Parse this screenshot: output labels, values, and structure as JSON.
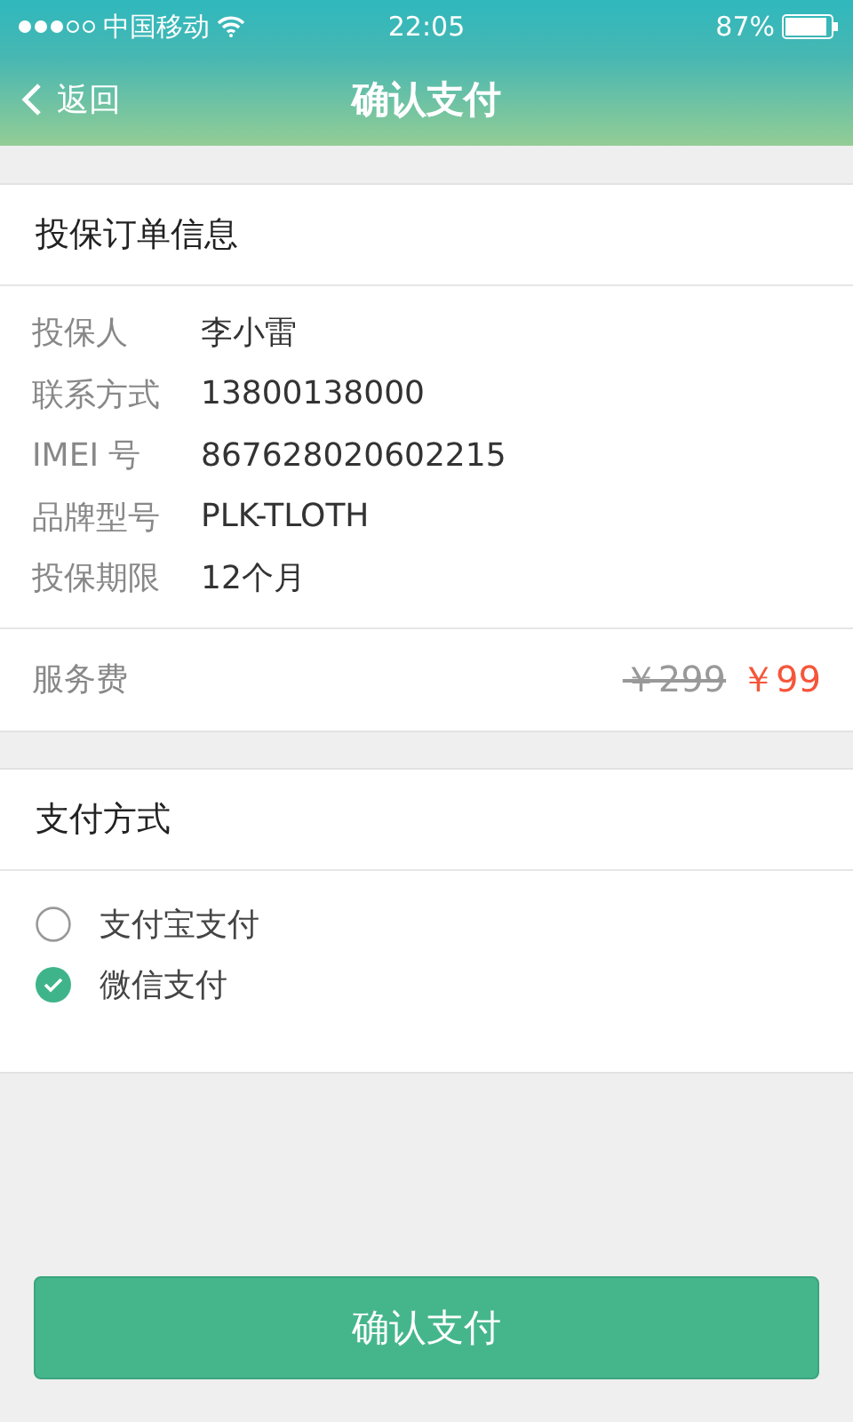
{
  "status_bar": {
    "carrier": "中国移动",
    "time": "22:05",
    "battery": "87%"
  },
  "nav": {
    "back": "返回",
    "title": "确认支付"
  },
  "order": {
    "title": "投保订单信息",
    "fields": [
      {
        "label": "投保人",
        "value": "李小雷"
      },
      {
        "label": "联系方式",
        "value": "13800138000"
      },
      {
        "label": "IMEI 号",
        "value": "867628020602215"
      },
      {
        "label": "品牌型号",
        "value": "PLK-TLOTH"
      },
      {
        "label": "投保期限",
        "value": "12个月"
      }
    ],
    "fee": {
      "label": "服务费",
      "original": "￥299",
      "price": "￥99"
    }
  },
  "payment": {
    "title": "支付方式",
    "options": [
      {
        "label": "支付宝支付",
        "selected": false
      },
      {
        "label": "微信支付",
        "selected": true
      }
    ]
  },
  "confirm_button": "确认支付"
}
